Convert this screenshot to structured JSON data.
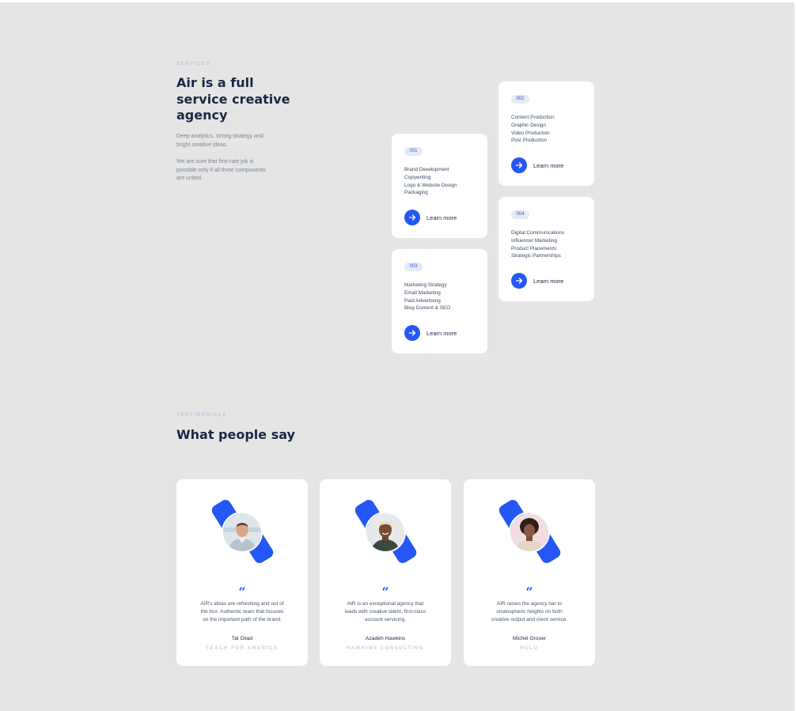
{
  "services": {
    "eyebrow": "SERVICES",
    "title_line1": "Air is a full",
    "title_line2": "service creative",
    "title_line3": "agency",
    "intro_p1_line1": "Deep analytics, strong strategy and",
    "intro_p1_line2": "bright creative ideas.",
    "intro_p2_line1": "We are sure that first-rate job is",
    "intro_p2_line2": "possible only if all three components",
    "intro_p2_line3": "are united.",
    "learn_more_label": "Learn more",
    "cards": [
      {
        "number": "001",
        "items": [
          "Brand Development",
          "Copywriting",
          "Logo & Website Design",
          "Packaging"
        ]
      },
      {
        "number": "002",
        "items": [
          "Content Production",
          "Graphic Design",
          "Video Production",
          "Post Production"
        ]
      },
      {
        "number": "003",
        "items": [
          "Marketing Strategy",
          "Email Marketing",
          "Paid Advertising",
          "Blog Content & SEO"
        ]
      },
      {
        "number": "004",
        "items": [
          "Digital Communications",
          "Influencer Marketing",
          "Product Placements",
          "Strategic Partnerships"
        ]
      }
    ]
  },
  "testimonials": {
    "eyebrow": "TESTIMONIALS",
    "title": "What people say",
    "quote_glyph": "“",
    "items": [
      {
        "text_line1": "AIR's ideas are refreshing and out of",
        "text_line2": "the box. Authentic team that focuses",
        "text_line3": "on the important path of the brand.",
        "name": "Tal Gilad",
        "company": "TEACH FOR AMERICA"
      },
      {
        "text_line1": "AIR is an exceptional agency that",
        "text_line2": "leads with creative talent, first-class",
        "text_line3": "account servicing.",
        "name": "Azadeh Hawkins",
        "company": "HAWKINS CONSULTING"
      },
      {
        "text_line1": "AIR raises the agency bar to",
        "text_line2": "stratospheric heights on both",
        "text_line3": "creative output and client service.",
        "name": "Michel Grover",
        "company": "HULU"
      }
    ]
  },
  "colors": {
    "accent": "#2457f5",
    "page_background": "#e5e5e5",
    "card_background": "#ffffff",
    "heading": "#1b2746",
    "eyebrow": "#b8c6dc"
  },
  "icons": {
    "learn_more": "arrow-right-icon",
    "quote": "quote-icon"
  }
}
